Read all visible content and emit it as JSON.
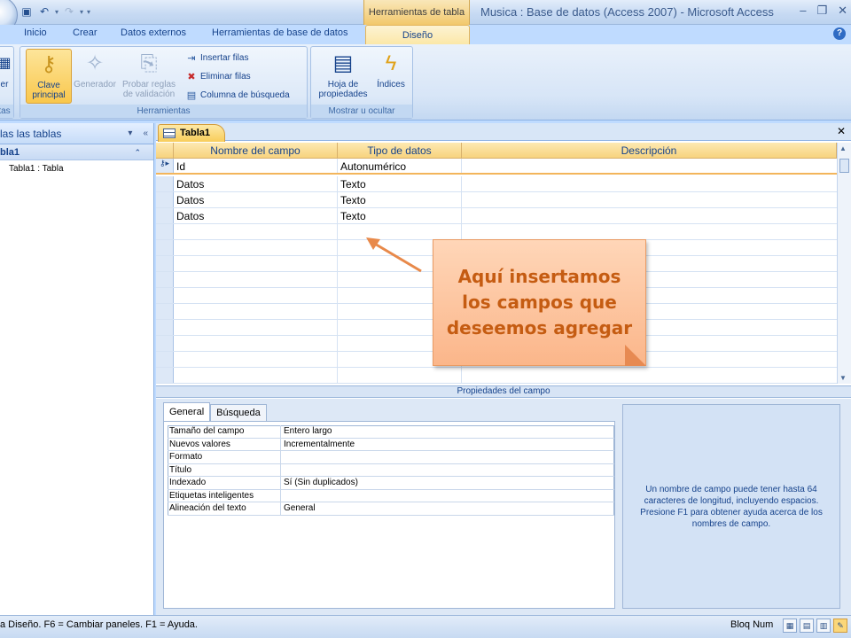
{
  "titlebar": {
    "context_tools": "Herramientas de tabla",
    "app_title": "Musica : Base de datos (Access 2007) - Microsoft Access"
  },
  "tabs": [
    "Inicio",
    "Crear",
    "Datos externos",
    "Herramientas de base de datos"
  ],
  "active_tab": "Diseño",
  "ribbon": {
    "partial_left_btn": "er",
    "partial_left_group": "tas",
    "clave_principal": "Clave principal",
    "generador": "Generador",
    "probar_reglas": "Probar reglas de validación",
    "insertar_filas": "Insertar filas",
    "eliminar_filas": "Eliminar filas",
    "columna_busqueda": "Columna de búsqueda",
    "herramientas_label": "Herramientas",
    "hoja_propiedades": "Hoja de propiedades",
    "indices": "Índices",
    "mostrar_label": "Mostrar u ocultar"
  },
  "nav": {
    "header": "las las tablas",
    "group": "bla1",
    "item": "Tabla1 : Tabla"
  },
  "doc": {
    "tab_label": "Tabla1",
    "headers": [
      "Nombre del campo",
      "Tipo de datos",
      "Descripción"
    ],
    "rows": [
      {
        "name": "Id",
        "type": "Autonumérico",
        "desc": ""
      },
      {
        "name": "Datos",
        "type": "Texto",
        "desc": ""
      },
      {
        "name": "Datos",
        "type": "Texto",
        "desc": ""
      },
      {
        "name": "Datos",
        "type": "Texto",
        "desc": ""
      }
    ]
  },
  "callout": "Aquí insertamos los campos que deseemos agregar",
  "properties": {
    "bar_title": "Propiedades del campo",
    "tabs": [
      "General",
      "Búsqueda"
    ],
    "rows": [
      {
        "label": "Tamaño del campo",
        "value": "Entero largo"
      },
      {
        "label": "Nuevos valores",
        "value": "Incrementalmente"
      },
      {
        "label": "Formato",
        "value": ""
      },
      {
        "label": "Título",
        "value": ""
      },
      {
        "label": "Indexado",
        "value": "Sí (Sin duplicados)"
      },
      {
        "label": "Etiquetas inteligentes",
        "value": ""
      },
      {
        "label": "Alineación del texto",
        "value": "General"
      }
    ],
    "help_text": "Un nombre de campo puede tener hasta 64 caracteres de longitud, incluyendo espacios. Presione F1 para obtener ayuda acerca de los nombres de campo."
  },
  "status": {
    "text": "a Diseño.  F6 = Cambiar paneles.  F1 = Ayuda.",
    "bloq": "Bloq Num"
  }
}
